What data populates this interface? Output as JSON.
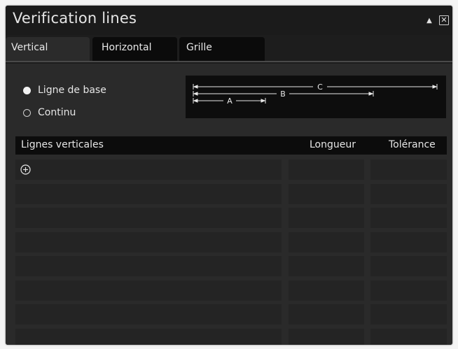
{
  "window": {
    "title": "Verification lines",
    "collapse_glyph": "▲",
    "close_glyph": "✕"
  },
  "tabs": [
    {
      "label": "Vertical",
      "active": true
    },
    {
      "label": "Horizontal",
      "active": false
    },
    {
      "label": "Grille",
      "active": false
    }
  ],
  "mode": {
    "options": [
      {
        "label": "Ligne de base",
        "selected": true
      },
      {
        "label": "Continu",
        "selected": false
      }
    ]
  },
  "diagram": {
    "labels": {
      "a": "A",
      "b": "B",
      "c": "C"
    }
  },
  "table": {
    "columns": [
      "Lignes verticales",
      "Longueur",
      "Tolérance"
    ],
    "row_count": 8,
    "add_icon": "add-circle-icon"
  },
  "colors": {
    "window_bg": "#1d1d1d",
    "content_bg": "#2a2a2a",
    "header_bg": "#0c0c0c",
    "cell_bg": "#242424",
    "text": "#e6e6e6"
  }
}
